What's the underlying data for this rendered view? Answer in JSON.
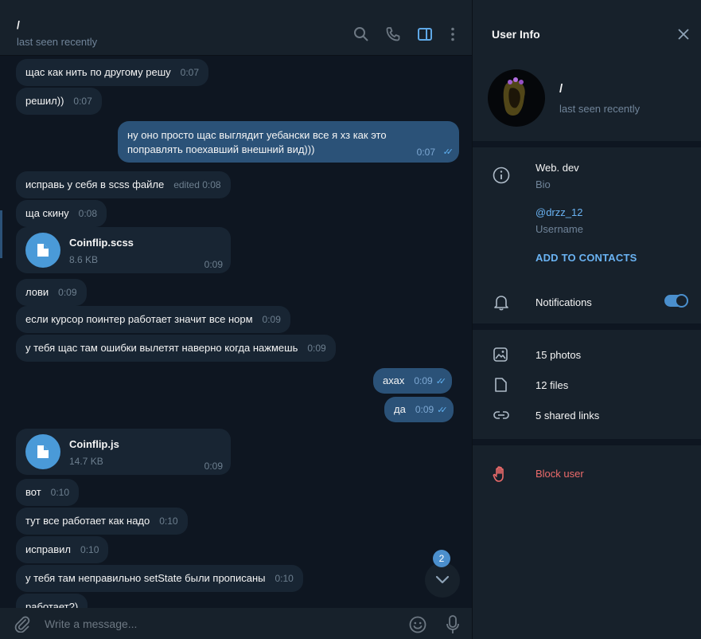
{
  "window_controls": [
    "–",
    "☐",
    "✕"
  ],
  "chat": {
    "title": "/",
    "status": "last seen recently",
    "icons": [
      "search-icon",
      "phone-icon",
      "sidebar-toggle-icon",
      "more-icon"
    ]
  },
  "messages": [
    {
      "text": "щас как нить по другому решу",
      "time": "0:07",
      "dir": "in"
    },
    {
      "text": "решил))",
      "time": "0:07",
      "dir": "in"
    },
    {
      "text_lines": [
        "ну оно просто щас выглядит уебански все я хз как это",
        "поправлять поехавший внешний вид)))"
      ],
      "time": "0:07",
      "dir": "out"
    },
    {
      "text": "исправь у себя в scss файле",
      "time": "edited 0:08",
      "dir": "in"
    },
    {
      "text": "ща скину",
      "time": "0:08",
      "dir": "in"
    },
    {
      "file_name": "Coinflip.scss",
      "file_size": "8.6 KB",
      "time": "0:09",
      "dir": "in"
    },
    {
      "text": "лови",
      "time": "0:09",
      "dir": "in"
    },
    {
      "text": "если курсор поинтер работает значит все норм",
      "time": "0:09",
      "dir": "in"
    },
    {
      "text": "у тебя щас там ошибки вылетят наверно когда нажмешь",
      "time": "0:09",
      "dir": "in"
    },
    {
      "text": "ахах",
      "time": "0:09",
      "dir": "out"
    },
    {
      "text": "да",
      "time": "0:09",
      "dir": "out"
    },
    {
      "file_name": "Coinflip.js",
      "file_size": "14.7 KB",
      "time": "0:09",
      "dir": "in"
    },
    {
      "text": "вот",
      "time": "0:10",
      "dir": "in"
    },
    {
      "text": "тут все работает как надо",
      "time": "0:10",
      "dir": "in"
    },
    {
      "text": "исправил",
      "time": "0:10",
      "dir": "in"
    },
    {
      "text": "у тебя там неправильно setState были прописаны",
      "time": "0:10",
      "dir": "in"
    },
    {
      "text": "работает?)",
      "time": "",
      "dir": "in"
    }
  ],
  "scroll_badge": "2",
  "composer": {
    "placeholder": "Write a message..."
  },
  "info": {
    "title": "User Info",
    "name": "/",
    "status": "last seen recently",
    "bio": "Web. dev",
    "bio_label": "Bio",
    "username": "@drzz_12",
    "username_label": "Username",
    "add_contacts": "ADD TO CONTACTS",
    "notifications": "Notifications",
    "notifications_on": true,
    "photos": "15 photos",
    "files": "12 files",
    "links": "5 shared links",
    "block": "Block user"
  },
  "colors": {
    "background": "#0e1621",
    "panel": "#17212b",
    "incoming_bubble": "#182533",
    "outgoing_bubble": "#2b5278",
    "accent": "#6ab3f3",
    "danger": "#ec6b6b"
  }
}
